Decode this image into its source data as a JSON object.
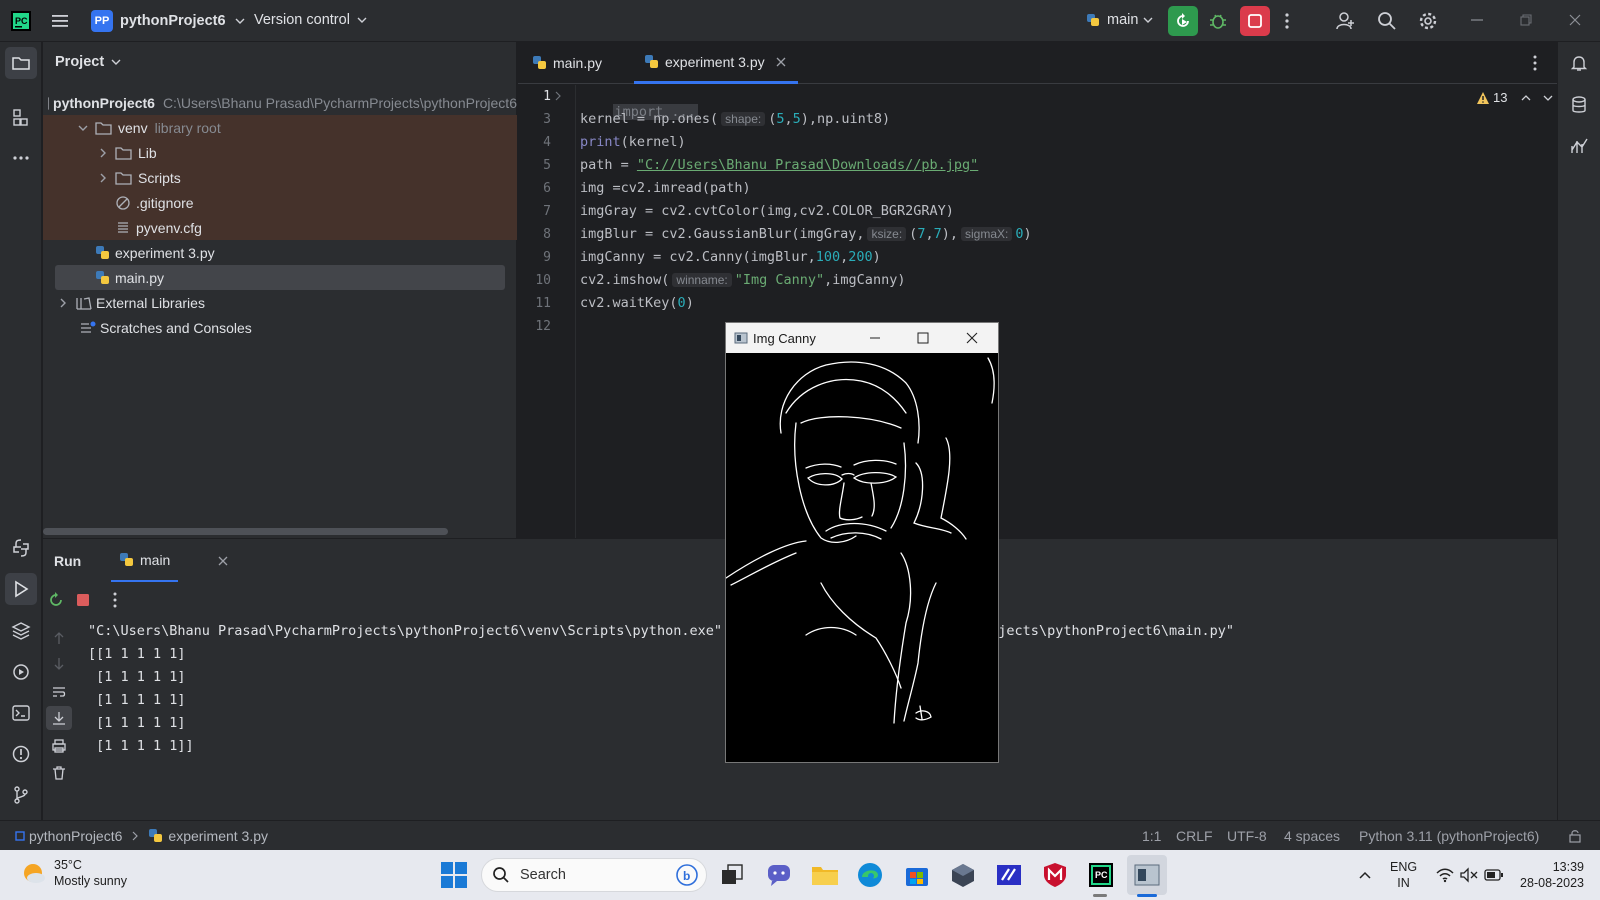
{
  "titlebar": {
    "project_badge": "PP",
    "project_name": "pythonProject6",
    "version_control": "Version control",
    "run_config": "main"
  },
  "project_panel": {
    "title": "Project",
    "tree": [
      {
        "label": "pythonProject6",
        "hint": "C:\\Users\\Bhanu Prasad\\PycharmProjects\\pythonProject6",
        "type": "root-folder"
      },
      {
        "label": "venv",
        "hint": "library root",
        "type": "folder"
      },
      {
        "label": "Lib",
        "type": "folder"
      },
      {
        "label": "Scripts",
        "type": "folder"
      },
      {
        "label": ".gitignore",
        "type": "ignore-file"
      },
      {
        "label": "pyvenv.cfg",
        "type": "cfg-file"
      },
      {
        "label": "experiment 3.py",
        "type": "python-file"
      },
      {
        "label": "main.py",
        "type": "python-file"
      },
      {
        "label": "External Libraries",
        "type": "libraries"
      },
      {
        "label": "Scratches and Consoles",
        "type": "scratches"
      }
    ]
  },
  "editor": {
    "tabs": [
      {
        "label": "main.py",
        "active": false
      },
      {
        "label": "experiment 3.py",
        "active": true
      }
    ],
    "warnings_count": "13",
    "line_numbers": [
      "1",
      "3",
      "4",
      "5",
      "6",
      "7",
      "8",
      "9",
      "10",
      "11",
      "12"
    ],
    "code": {
      "l1": "import ...",
      "l3a": "kernel = np.ones(",
      "l3_hint": "shape:",
      "l3b": "(",
      "l3_n1": "5",
      "l3c": ",",
      "l3_n2": "5",
      "l3d": "),np.uint8)",
      "l4_fn": "print",
      "l4b": "(kernel)",
      "l5a": "path = ",
      "l5_str": "\"C://Users\\Bhanu Prasad\\Downloads//pb.jpg\"",
      "l6": "img =cv2.imread(path)",
      "l7": "imgGray = cv2.cvtColor(img,cv2.COLOR_BGR2GRAY)",
      "l8a": "imgBlur = cv2.GaussianBlur(imgGray,",
      "l8_hint1": "ksize:",
      "l8b": "(",
      "l8_n1": "7",
      "l8c": ",",
      "l8_n2": "7",
      "l8d": "),",
      "l8_hint2": "sigmaX:",
      "l8_n3": "0",
      "l8e": ")",
      "l9a": "imgCanny = cv2.Canny(imgBlur,",
      "l9_n1": "100",
      "l9b": ",",
      "l9_n2": "200",
      "l9c": ")",
      "l10a": "cv2.imshow(",
      "l10_hint": "winname:",
      "l10_str": "\"Img Canny\"",
      "l10b": ",imgCanny)",
      "l11a": "cv2.waitKey(",
      "l11_n": "0",
      "l11b": ")"
    }
  },
  "run_panel": {
    "title": "Run",
    "tab_label": "main",
    "output_lines": [
      "\"C:\\Users\\Bhanu Prasad\\PycharmProjects\\pythonProject6\\venv\\Scripts\\python.exe\" \"C:\\Users\\Bhanu Prasad\\PycharmProjects\\pythonProject6\\main.py\"",
      "[[1 1 1 1 1]",
      " [1 1 1 1 1]",
      " [1 1 1 1 1]",
      " [1 1 1 1 1]",
      " [1 1 1 1 1]]"
    ]
  },
  "image_window": {
    "title": "Img Canny"
  },
  "statusbar": {
    "breadcrumb_project": "pythonProject6",
    "breadcrumb_file": "experiment 3.py",
    "position": "1:1",
    "line_ending": "CRLF",
    "encoding": "UTF-8",
    "indent": "4 spaces",
    "interpreter": "Python 3.11 (pythonProject6)"
  },
  "taskbar": {
    "weather_temp": "35°C",
    "weather_desc": "Mostly sunny",
    "search_placeholder": "Search",
    "lang_line1": "ENG",
    "lang_line2": "IN",
    "time": "13:39",
    "date": "28-08-2023"
  },
  "colors": {
    "accent_blue": "#3574f0",
    "run_green": "#2e9a4e",
    "stop_red": "#db3b4b",
    "venv_highlight": "#45322b"
  }
}
